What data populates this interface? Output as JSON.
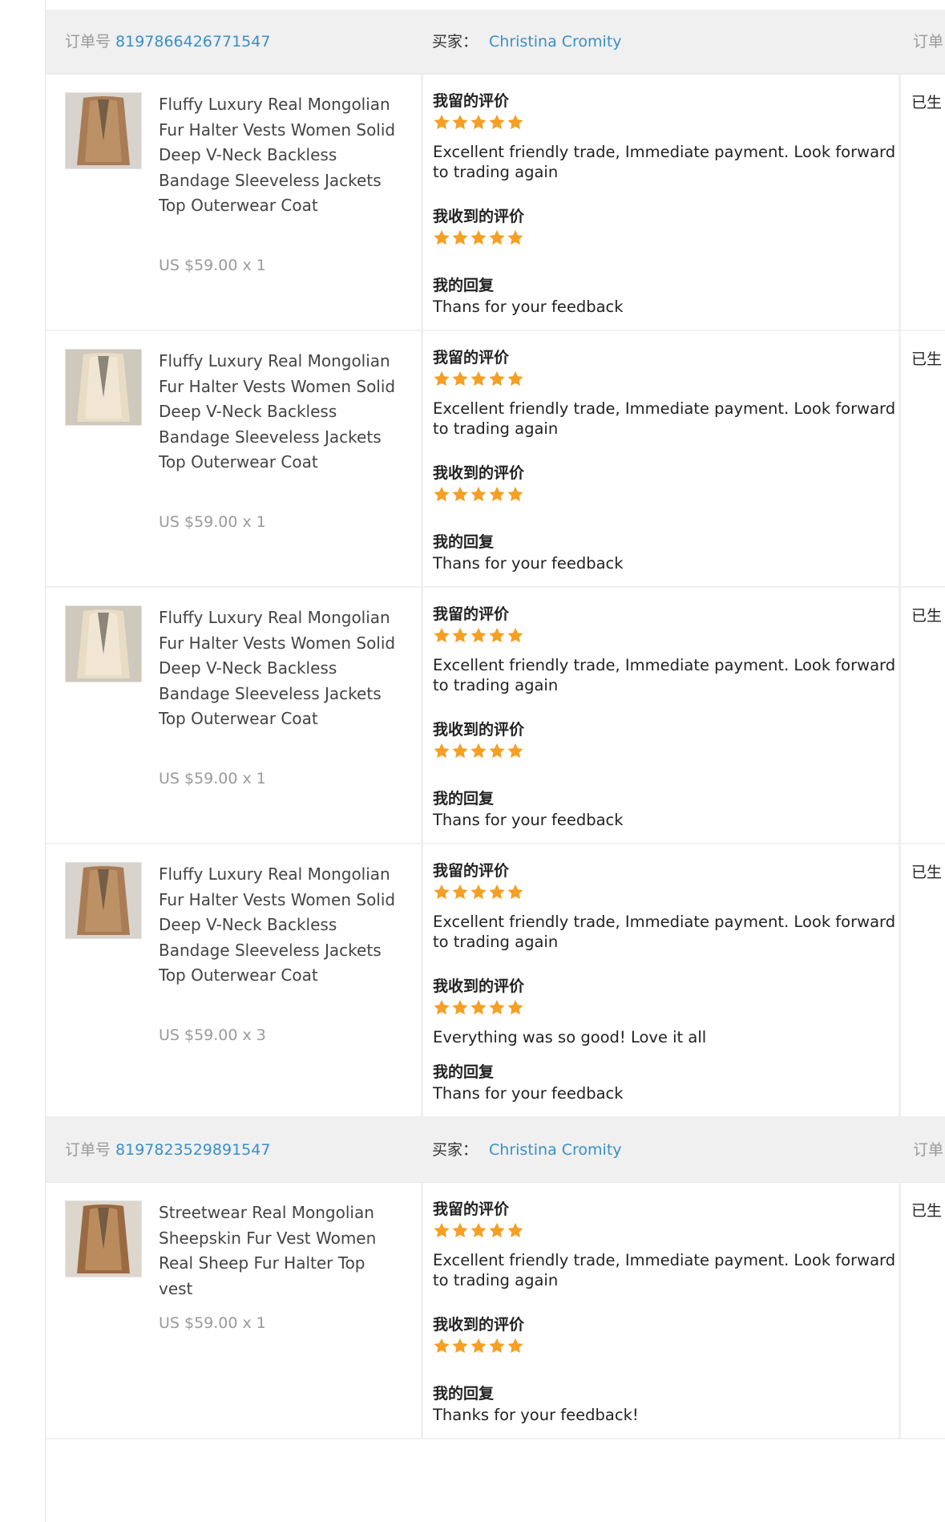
{
  "labels": {
    "order_no": "订单号",
    "buyer": "买家：",
    "col3_header": "订单",
    "my_review": "我留的评价",
    "received_review": "我收到的评价",
    "my_reply": "我的回复",
    "status": "已生"
  },
  "colors": {
    "link": "#3a8fc7",
    "star": "#f5a024",
    "header_bg": "#f0f0f0",
    "muted": "#9a9a9a"
  },
  "star_icon": "star-icon",
  "orders": [
    {
      "order_number": "8197866426771547",
      "buyer_name": "Christina Cromity",
      "items": [
        {
          "thumb": "brown-fur-vest",
          "name": "Fluffy Luxury Real Mongolian Fur Halter Vests Women Solid Deep V-Neck Backless Bandage Sleeveless Jackets Top Outerwear Coat",
          "price": "US $59.00 x 1",
          "my_review_stars": 5,
          "my_review_text": "Excellent friendly trade, Immediate payment. Look forward to trading again",
          "received_stars": 5,
          "received_text": "",
          "my_reply_text": "Thans for your feedback"
        },
        {
          "thumb": "cream-fur-vest",
          "name": "Fluffy Luxury Real Mongolian Fur Halter Vests Women Solid Deep V-Neck Backless Bandage Sleeveless Jackets Top Outerwear Coat",
          "price": "US $59.00 x 1",
          "my_review_stars": 5,
          "my_review_text": "Excellent friendly trade, Immediate payment. Look forward to trading again",
          "received_stars": 5,
          "received_text": "",
          "my_reply_text": "Thans for your feedback"
        },
        {
          "thumb": "cream-fur-vest",
          "name": "Fluffy Luxury Real Mongolian Fur Halter Vests Women Solid Deep V-Neck Backless Bandage Sleeveless Jackets Top Outerwear Coat",
          "price": "US $59.00 x 1",
          "my_review_stars": 5,
          "my_review_text": "Excellent friendly trade, Immediate payment. Look forward to trading again",
          "received_stars": 5,
          "received_text": "",
          "my_reply_text": "Thans for your feedback"
        },
        {
          "thumb": "brown-fur-vest",
          "name": "Fluffy Luxury Real Mongolian Fur Halter Vests Women Solid Deep V-Neck Backless Bandage Sleeveless Jackets Top Outerwear Coat",
          "price": "US $59.00 x 3",
          "my_review_stars": 5,
          "my_review_text": "Excellent friendly trade, Immediate payment. Look forward to trading again",
          "received_stars": 5,
          "received_text": "Everything was so good! Love it all",
          "my_reply_text": "Thans for your feedback"
        }
      ]
    },
    {
      "order_number": "8197823529891547",
      "buyer_name": "Christina Cromity",
      "items": [
        {
          "thumb": "sheepskin-vest",
          "name": "Streetwear Real Mongolian Sheepskin Fur Vest Women Real Sheep Fur Halter Top vest",
          "price": "US $59.00 x 1",
          "my_review_stars": 5,
          "my_review_text": "Excellent friendly trade, Immediate payment. Look forward to trading again",
          "received_stars": 5,
          "received_text": "",
          "my_reply_text": "Thanks for your feedback!"
        }
      ]
    }
  ]
}
